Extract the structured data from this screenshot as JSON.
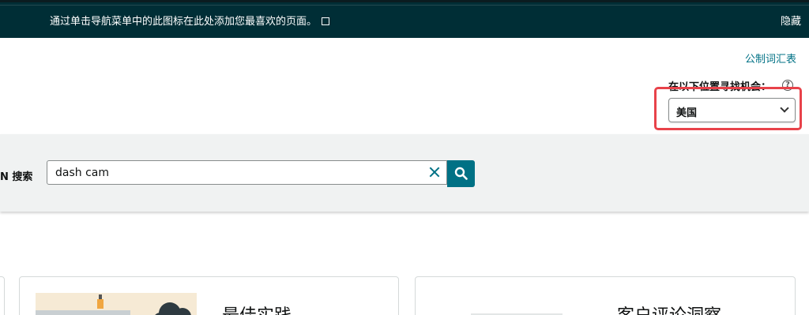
{
  "topbar": {
    "message": "通过单击导航菜单中的此图标在此处添加您最喜欢的页面。",
    "hide_label": "隐藏"
  },
  "glossary_link": "公制词汇表",
  "location": {
    "label": "在以下位置寻找机会：",
    "help_symbol": "?",
    "selected": "美国"
  },
  "search": {
    "label": "N 搜索",
    "value": "dash cam"
  },
  "cards": [
    {
      "title": "最佳实践"
    },
    {
      "title": "客户评论洞察"
    }
  ],
  "colors": {
    "topbar_bg": "#002e36",
    "accent": "#007185",
    "highlight": "#e8424a",
    "band_bg": "#f0f2f2"
  }
}
